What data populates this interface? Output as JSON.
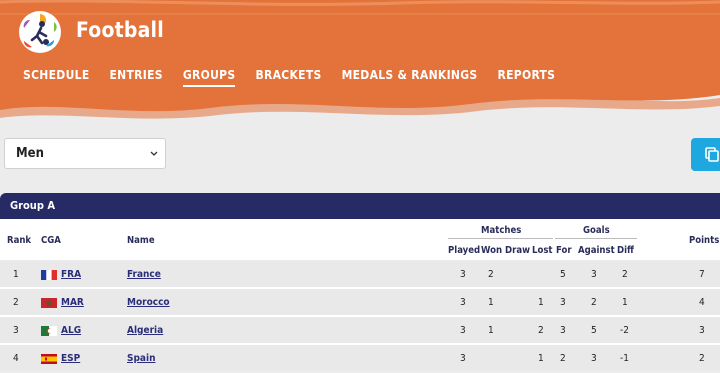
{
  "header": {
    "sport": "Football",
    "brand_color": "#e3733a",
    "nav": [
      {
        "label": "SCHEDULE",
        "active": false
      },
      {
        "label": "ENTRIES",
        "active": false
      },
      {
        "label": "GROUPS",
        "active": true
      },
      {
        "label": "BRACKETS",
        "active": false
      },
      {
        "label": "MEDALS & RANKINGS",
        "active": false
      },
      {
        "label": "REPORTS",
        "active": false
      }
    ]
  },
  "filter": {
    "selected": "Men",
    "icon": "chevron-down-icon"
  },
  "copy_button": {
    "icon": "copy-icon",
    "color": "#1fa7e0"
  },
  "group": {
    "title": "Group A",
    "headers": {
      "rank": "Rank",
      "cga": "CGA",
      "name": "Name",
      "matches": "Matches",
      "goals": "Goals",
      "points": "Points",
      "played": "Played",
      "won": "Won",
      "draw": "Draw",
      "lost": "Lost",
      "for": "For",
      "against": "Against",
      "diff": "Diff"
    },
    "rows": [
      {
        "rank": "1",
        "cga": "FRA",
        "name": "France",
        "played": "3",
        "won": "2",
        "draw": "",
        "lost": "",
        "for": "5",
        "against": "3",
        "diff": "2",
        "points": "7"
      },
      {
        "rank": "2",
        "cga": "MAR",
        "name": "Morocco",
        "played": "3",
        "won": "1",
        "draw": "",
        "lost": "1",
        "for": "3",
        "against": "2",
        "diff": "1",
        "points": "4"
      },
      {
        "rank": "3",
        "cga": "ALG",
        "name": "Algeria",
        "played": "3",
        "won": "1",
        "draw": "",
        "lost": "2",
        "for": "3",
        "against": "5",
        "diff": "-2",
        "points": "3"
      },
      {
        "rank": "4",
        "cga": "ESP",
        "name": "Spain",
        "played": "3",
        "won": "",
        "draw": "",
        "lost": "1",
        "for": "2",
        "against": "3",
        "diff": "-1",
        "points": "2"
      }
    ]
  }
}
